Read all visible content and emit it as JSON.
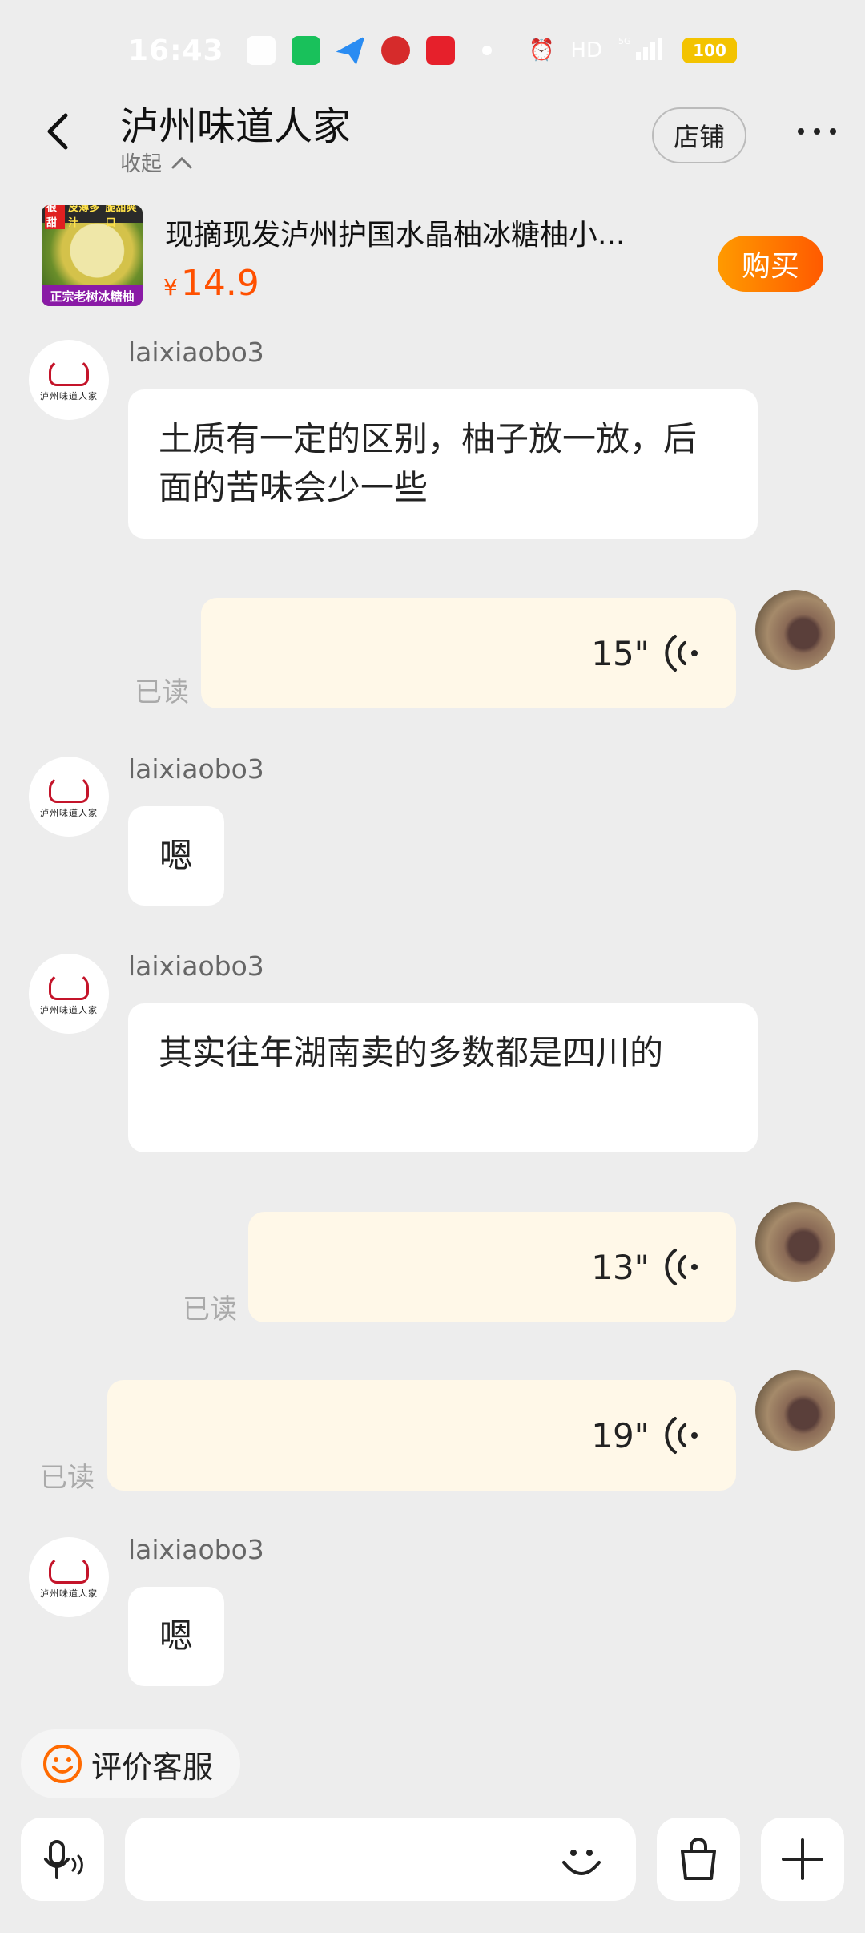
{
  "status_bar": {
    "time": "16:43",
    "battery": "100",
    "network_label": "HD",
    "signal_label": "5G"
  },
  "header": {
    "title": "泸州味道人家",
    "collapse_label": "收起",
    "store_button": "店铺"
  },
  "product": {
    "name": "现摘现发泸州护国水晶柚冰糖柚小...",
    "currency": "¥",
    "price": "14.9",
    "buy_button": "购买",
    "thumb_tag_1": "很甜",
    "thumb_tag_2": "皮薄多汁",
    "thumb_tag_3": "脆甜爽口",
    "thumb_bottom": "正宗老树冰糖柚"
  },
  "messages": [
    {
      "sender": "laixiaobo3",
      "text": "土质有一定的区别，柚子放一放，后面的苦味会少一些"
    },
    {
      "duration": "15\"",
      "status": "已读"
    },
    {
      "sender": "laixiaobo3",
      "text": "嗯"
    },
    {
      "sender": "laixiaobo3",
      "text": "其实往年湖南卖的多数都是四川的"
    },
    {
      "duration": "13\"",
      "status": "已读"
    },
    {
      "duration": "19\"",
      "status": "已读"
    },
    {
      "sender": "laixiaobo3",
      "text": "嗯"
    }
  ],
  "shop_avatar_text": "泸州味道人家",
  "rate_service": "评价客服",
  "input": {
    "placeholder": ""
  }
}
